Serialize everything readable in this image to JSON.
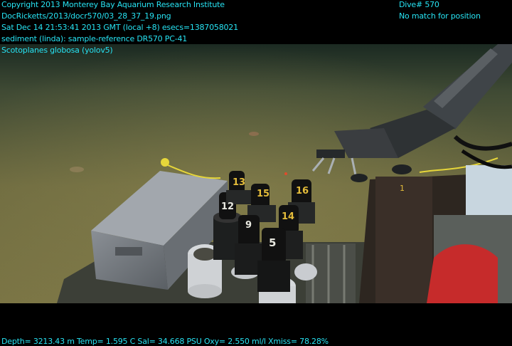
{
  "overlay": {
    "line1": "Copyright 2013 Monterey Bay Aquarium Research Institute",
    "line2": "DocRicketts/2013/docr570/03_28_37_19.png",
    "line3": "Sat Dec 14 21:53:41 2013 GMT (local +8)  esecs=1387058021",
    "line4": "sediment (linda): sample-reference DR570 PC-41",
    "line5": "Scotoplanes globosa (yolov5)",
    "dive": "Dive# 570",
    "position": "No match for position",
    "telemetry": "Depth= 3213.43 m  Temp= 1.595 C  Sal= 34.668 PSU  Oxy= 2.550 ml/l  Xmiss= 78.28%"
  },
  "scene": {
    "sample_tube_labels": [
      "13",
      "15",
      "16",
      "12",
      "9",
      "14",
      "5"
    ],
    "vehicle_label": "1"
  },
  "colors": {
    "overlay_text": "#27e3f3",
    "seafloor": "#6f6a3f",
    "water": "#1c2a22"
  }
}
